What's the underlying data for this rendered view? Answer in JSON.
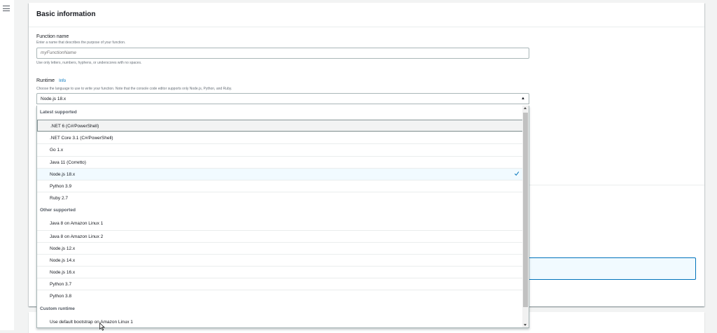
{
  "card": {
    "title": "Basic information"
  },
  "function_name": {
    "label": "Function name",
    "description": "Enter a name that describes the purpose of your function.",
    "placeholder": "myFunctionName",
    "constraint": "Use only letters, numbers, hyphens, or underscores with no spaces."
  },
  "runtime": {
    "label": "Runtime",
    "info_link": "Info",
    "description": "Choose the language to use to write your function. Note that the console code editor supports only Node.js, Python, and Ruby.",
    "selected": "Node.js 18.x",
    "groups": [
      {
        "header": "Latest supported",
        "options": [
          {
            "label": ".NET 6 (C#/PowerShell)",
            "state": "focused"
          },
          {
            "label": ".NET Core 3.1 (C#/PowerShell)",
            "state": ""
          },
          {
            "label": "Go 1.x",
            "state": ""
          },
          {
            "label": "Java 11 (Corretto)",
            "state": ""
          },
          {
            "label": "Node.js 18.x",
            "state": "selected"
          },
          {
            "label": "Python 3.9",
            "state": ""
          },
          {
            "label": "Ruby 2.7",
            "state": ""
          }
        ]
      },
      {
        "header": "Other supported",
        "options": [
          {
            "label": "Java 8 on Amazon Linux 1",
            "state": ""
          },
          {
            "label": "Java 8 on Amazon Linux 2",
            "state": ""
          },
          {
            "label": "Node.js 12.x",
            "state": ""
          },
          {
            "label": "Node.js 14.x",
            "state": ""
          },
          {
            "label": "Node.js 16.x",
            "state": ""
          },
          {
            "label": "Python 3.7",
            "state": ""
          },
          {
            "label": "Python 3.8",
            "state": ""
          }
        ]
      },
      {
        "header": "Custom runtime",
        "options": [
          {
            "label": "Use default bootstrap on Amazon Linux 1",
            "state": ""
          }
        ]
      }
    ]
  },
  "colors": {
    "accent": "#0073bb",
    "check": "#0073bb",
    "selected_bg": "#f1faff"
  }
}
